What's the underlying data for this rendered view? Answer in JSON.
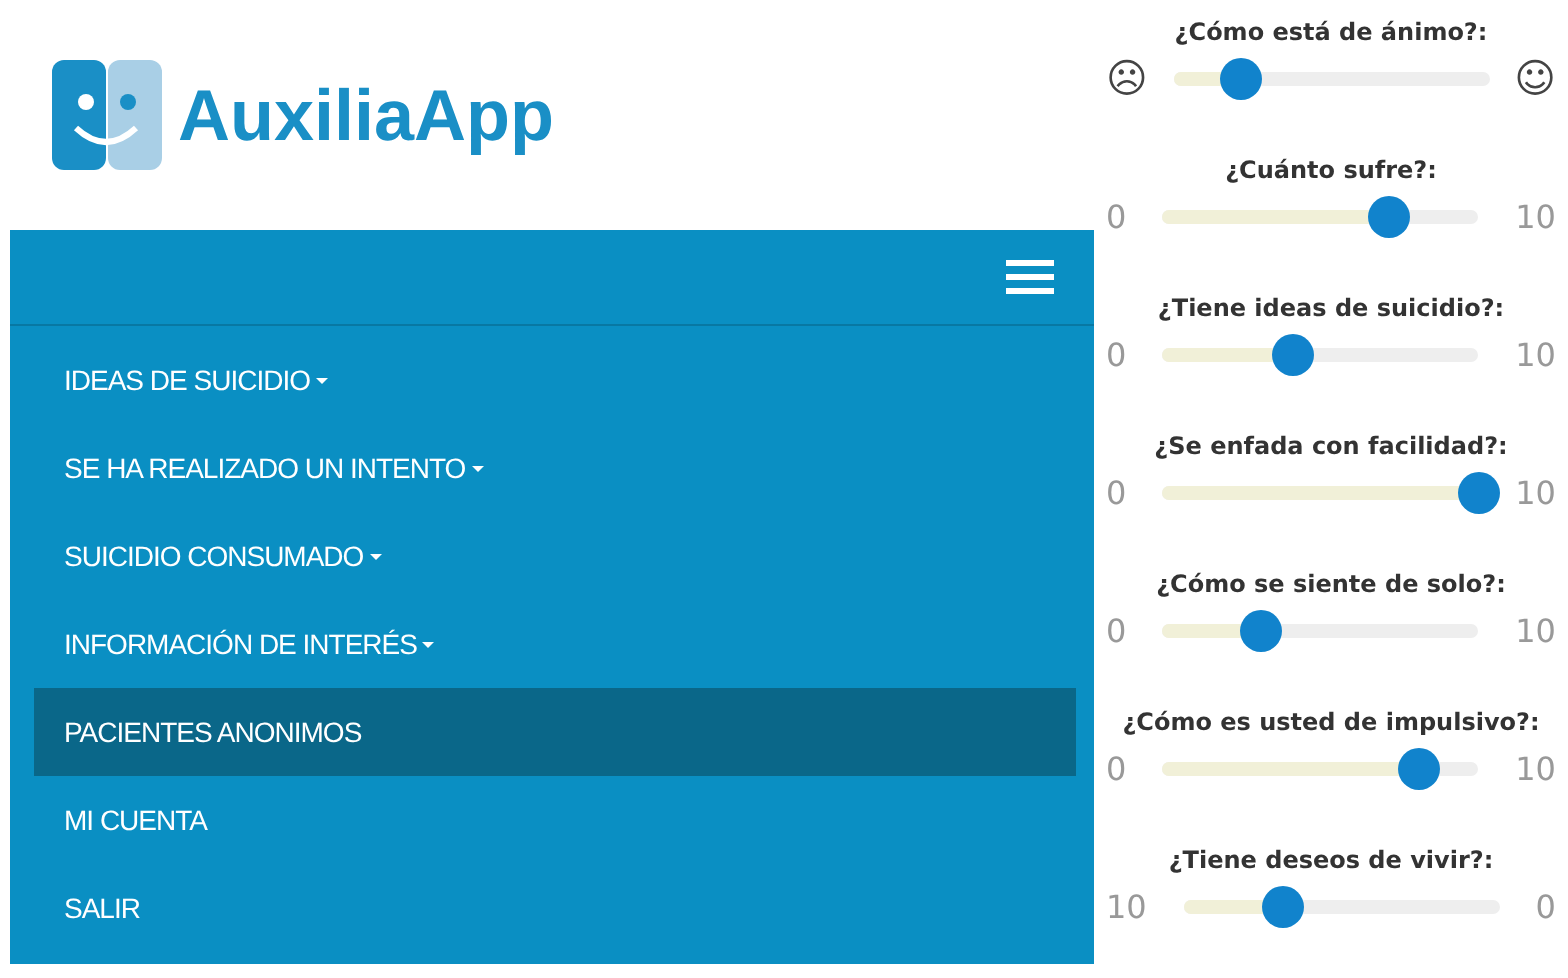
{
  "logo": {
    "name": "AuxiliaApp"
  },
  "nav": {
    "menu_items": [
      {
        "label": "IDEAS DE SUICIDIO",
        "dropdown": true,
        "selected": false
      },
      {
        "label": "SE HA REALIZADO UN INTENTO",
        "dropdown": true,
        "selected": false
      },
      {
        "label": "SUICIDIO CONSUMADO",
        "dropdown": true,
        "selected": false
      },
      {
        "label": "INFORMACIÓN DE INTERÉS",
        "dropdown": true,
        "selected": false
      },
      {
        "label": "PACIENTES ANONIMOS",
        "dropdown": false,
        "selected": true
      },
      {
        "label": "MI CUENTA",
        "dropdown": false,
        "selected": false
      },
      {
        "label": "SALIR",
        "dropdown": false,
        "selected": false
      }
    ]
  },
  "sliders": [
    {
      "label": "¿Cómo está de ánimo?:",
      "min_label": "☹",
      "max_label": "☺",
      "level": 0.21
    },
    {
      "label": "¿Cuánto sufre?:",
      "min_label": "0",
      "max_label": "10",
      "level": 0.71
    },
    {
      "label": "¿Tiene ideas de suicidio?:",
      "min_label": "0",
      "max_label": "10",
      "level": 0.41
    },
    {
      "label": "¿Se enfada con facilidad?:",
      "min_label": "0",
      "max_label": "10",
      "level": 1.0
    },
    {
      "label": "¿Cómo se siente de solo?:",
      "min_label": "0",
      "max_label": "10",
      "level": 0.31
    },
    {
      "label": "¿Cómo es usted de impulsivo?:",
      "min_label": "0",
      "max_label": "10",
      "level": 0.81
    },
    {
      "label": "¿Tiene deseos de vivir?:",
      "min_label": "10",
      "max_label": "0",
      "level": 0.31
    }
  ]
}
